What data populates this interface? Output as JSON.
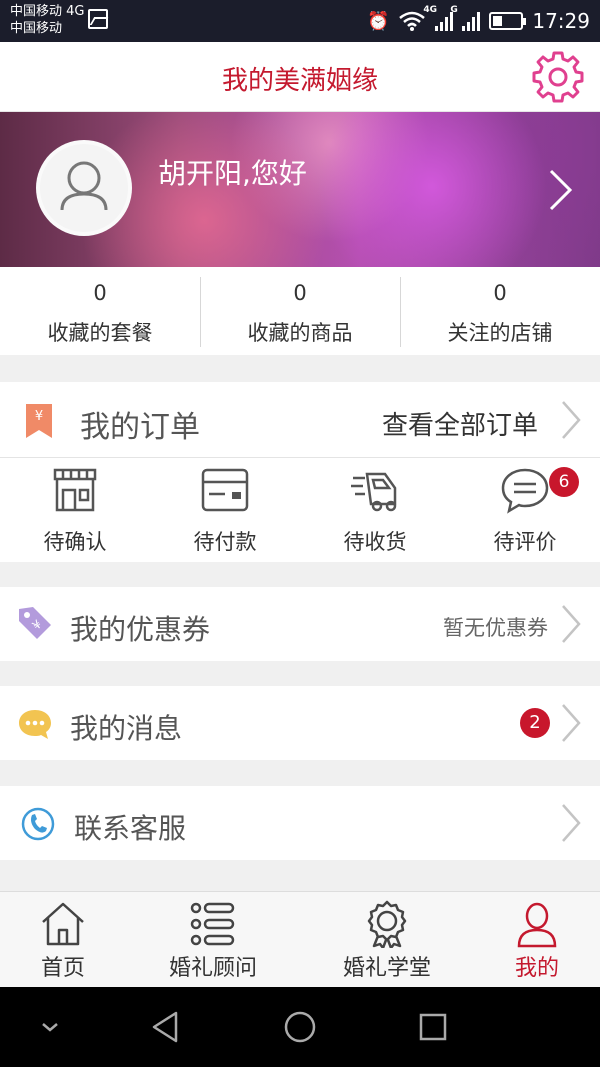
{
  "status_bar": {
    "carrier_line1": "中国移动 4G",
    "carrier_line2": "中国移动",
    "network_4g": "4G",
    "network_g": "G",
    "time": "17:29"
  },
  "header": {
    "title": "我的美满姻缘",
    "settings_icon": "gear-icon"
  },
  "profile": {
    "greeting": "胡开阳,您好"
  },
  "stats": [
    {
      "count": "0",
      "label": "收藏的套餐"
    },
    {
      "count": "0",
      "label": "收藏的商品"
    },
    {
      "count": "0",
      "label": "关注的店铺"
    }
  ],
  "orders": {
    "title": "我的订单",
    "view_all": "查看全部订单",
    "items": [
      {
        "label": "待确认",
        "icon": "shop-icon"
      },
      {
        "label": "待付款",
        "icon": "card-icon"
      },
      {
        "label": "待收货",
        "icon": "truck-icon"
      },
      {
        "label": "待评价",
        "icon": "comment-icon",
        "badge": "6"
      }
    ]
  },
  "coupons": {
    "label": "我的优惠券",
    "value": "暂无优惠券"
  },
  "messages": {
    "label": "我的消息",
    "badge": "2"
  },
  "service": {
    "label": "联系客服"
  },
  "tabbar": [
    {
      "label": "首页",
      "icon": "home-icon"
    },
    {
      "label": "婚礼顾问",
      "icon": "list-icon"
    },
    {
      "label": "婚礼学堂",
      "icon": "medal-icon"
    },
    {
      "label": "我的",
      "icon": "person-icon"
    }
  ],
  "colors": {
    "brand_red": "#c4192e",
    "pink_accent": "#e0408f",
    "badge_red": "#c8172c"
  }
}
